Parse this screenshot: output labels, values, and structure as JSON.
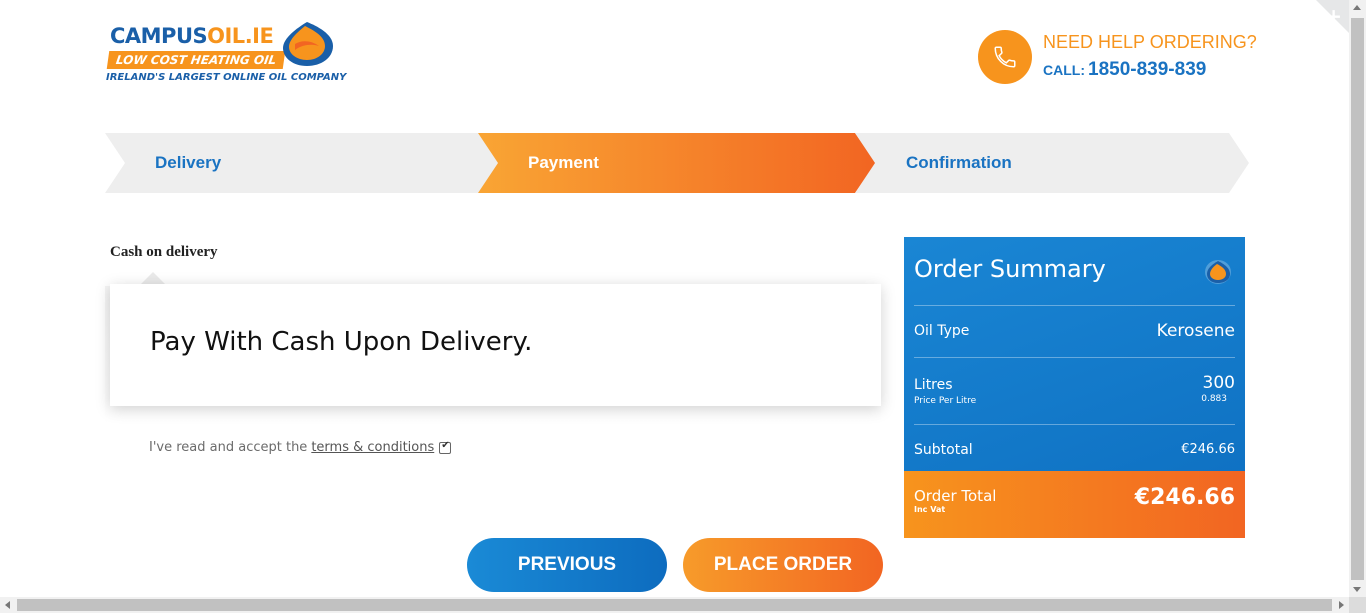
{
  "logo": {
    "brand_blue": "CAMPUS",
    "brand_orange": "OIL.IE",
    "tagline": "LOW COST HEATING OIL",
    "subtitle": "IRELAND'S LARGEST ONLINE OIL COMPANY"
  },
  "help": {
    "title": "NEED HELP ORDERING?",
    "call_label": "CALL:",
    "phone": "1850-839-839",
    "icon": "phone-icon"
  },
  "steps": [
    {
      "label": "Delivery",
      "state": "done"
    },
    {
      "label": "Payment",
      "state": "active"
    },
    {
      "label": "Confirmation",
      "state": "pending"
    }
  ],
  "payment": {
    "method_label": "Cash on delivery",
    "method_text": "Pay With Cash Upon Delivery.",
    "terms_prefix": "I've read and accept the",
    "terms_link": "terms & conditions",
    "terms_checked": true
  },
  "summary": {
    "title": "Order Summary",
    "oil_type_label": "Oil Type",
    "oil_type_value": "Kerosene",
    "litres_label": "Litres",
    "price_per_litre_label": "Price Per Litre",
    "litres_value": "300",
    "price_per_litre_value": "0.883",
    "subtotal_label": "Subtotal",
    "subtotal_value": "€246.66",
    "total_label": "Order Total",
    "total_sub_label": "Inc Vat",
    "total_value": "€246.66"
  },
  "buttons": {
    "previous": "PREVIOUS",
    "place_order": "PLACE ORDER"
  },
  "colors": {
    "brand_blue": "#1a73c2",
    "brand_orange": "#f7941d",
    "step_grey": "#eeeeee"
  }
}
